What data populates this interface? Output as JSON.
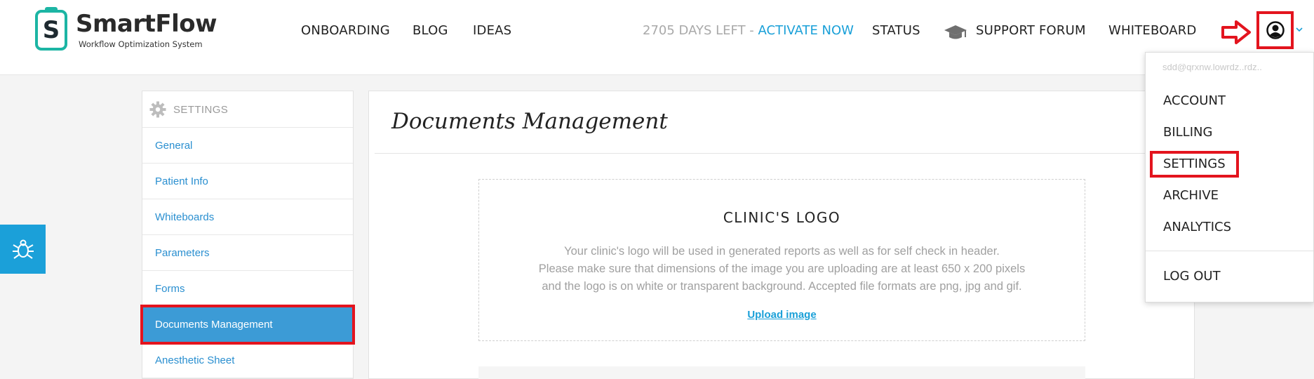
{
  "brand": {
    "name": "SmartFlow",
    "tagline": "Workflow Optimization System",
    "badge_letter": "S"
  },
  "nav": {
    "left": [
      "ONBOARDING",
      "BLOG",
      "IDEAS"
    ],
    "trial_days": "2705 DAYS LEFT - ",
    "activate": "ACTIVATE NOW",
    "status": "STATUS",
    "support": "SUPPORT FORUM",
    "whiteboard": "WHITEBOARD"
  },
  "icons": {
    "gear": "gear-icon",
    "bug": "bug-icon",
    "cap": "graduation-cap-icon",
    "avatar": "user-avatar-icon",
    "caret": "chevron-down-icon",
    "arrow": "red-arrow-icon"
  },
  "colors": {
    "accent": "#1aa0d8",
    "active_item": "#3c9bd6",
    "highlight": "#e3141e",
    "logo_teal": "#1cb5a4"
  },
  "sidebar": {
    "header": "SETTINGS",
    "items": [
      {
        "label": "General"
      },
      {
        "label": "Patient Info"
      },
      {
        "label": "Whiteboards"
      },
      {
        "label": "Parameters"
      },
      {
        "label": "Forms"
      },
      {
        "label": "Documents Management",
        "active": true
      },
      {
        "label": "Anesthetic Sheet"
      }
    ]
  },
  "main": {
    "title": "Documents Management",
    "logo_section": {
      "title": "CLINIC'S LOGO",
      "line1": "Your clinic's logo will be used in generated reports as well as for self check in header.",
      "line2": "Please make sure that dimensions of the image you are uploading are at least 650 x 200 pixels",
      "line3": "and the logo is on white or transparent background. Accepted file formats are png, jpg and gif.",
      "upload_link": "Upload image"
    }
  },
  "dropdown": {
    "email_partial": "sdd@qrxnw.lowrdz..rdz..",
    "items": [
      "ACCOUNT",
      "BILLING",
      "SETTINGS",
      "ARCHIVE",
      "ANALYTICS"
    ],
    "logout": "LOG OUT"
  }
}
